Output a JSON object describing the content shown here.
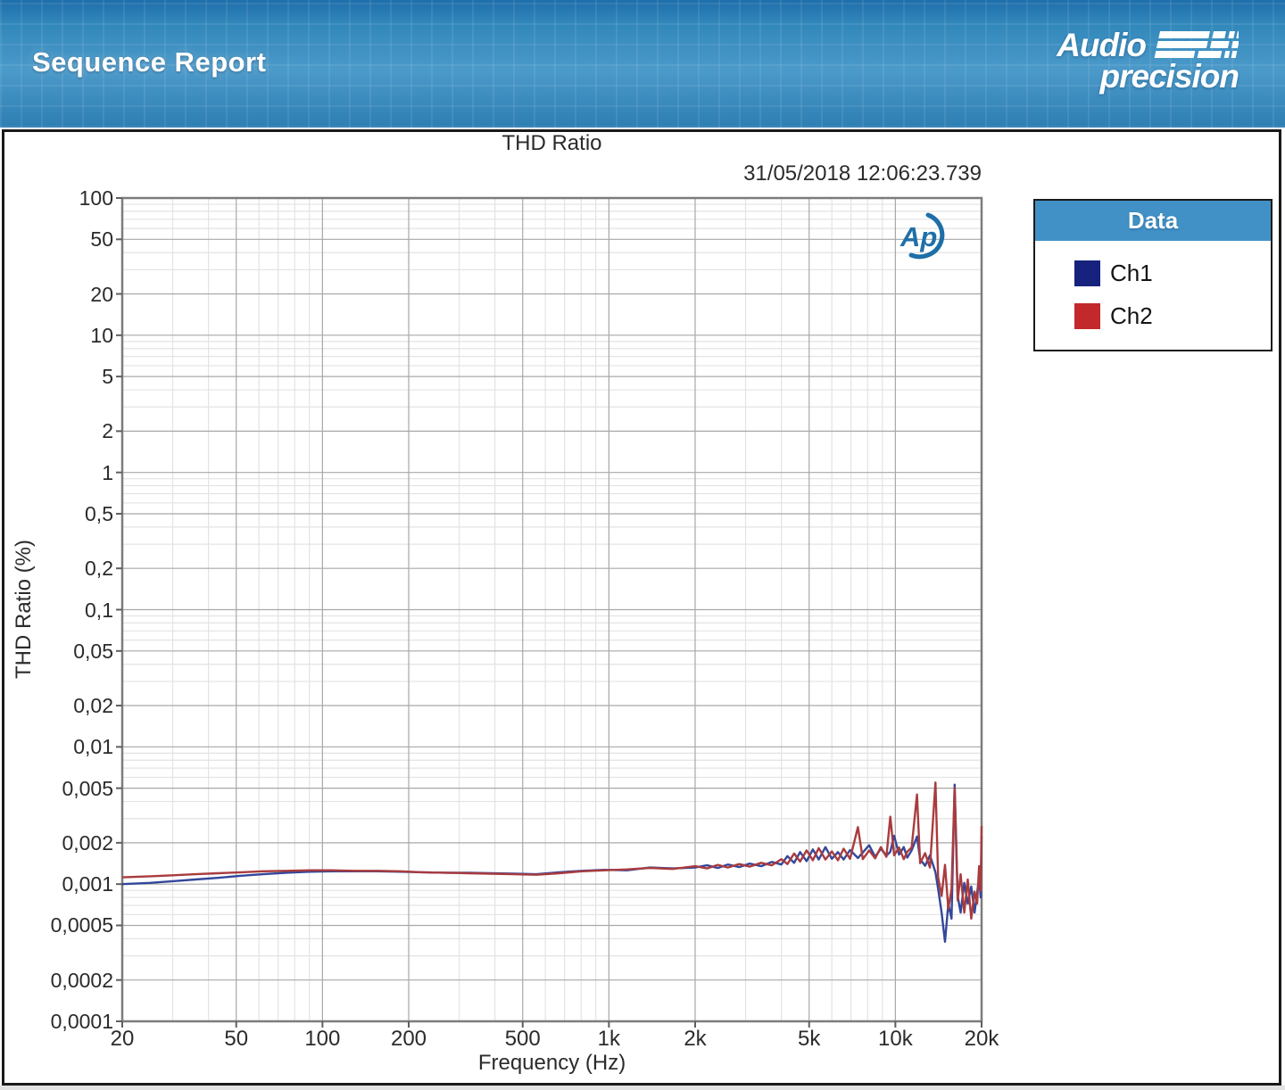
{
  "header": {
    "title": "Sequence Report",
    "brand_word1": "Audio",
    "brand_word2": "precision"
  },
  "report": {
    "timestamp": "31/05/2018 12:06:23.739",
    "legend": {
      "header": "Data",
      "items": [
        {
          "label": "Ch1",
          "color": "#16227d"
        },
        {
          "label": "Ch2",
          "color": "#c2282c"
        }
      ]
    }
  },
  "colors": {
    "banner_blue": "#3187ba",
    "legend_header_blue": "#4191c6",
    "ap_mark_blue": "#1e6fa8",
    "grid_major": "#a8a8a8",
    "grid_minor": "#e3e3e3",
    "plot_border": "#7c7c7c",
    "ch1_trace": "#33479a",
    "ch2_trace": "#a93b3e"
  },
  "chart_data": {
    "type": "line",
    "title": "THD Ratio",
    "xlabel": "Frequency (Hz)",
    "ylabel": "THD Ratio (%)",
    "x_scale": "log",
    "y_scale": "log",
    "xlim": [
      20,
      20000
    ],
    "ylim": [
      0.0001,
      100
    ],
    "grid": "log major+minor",
    "legend_position": "top-right outside",
    "x_ticks": [
      {
        "v": 20,
        "label": "20"
      },
      {
        "v": 50,
        "label": "50"
      },
      {
        "v": 100,
        "label": "100"
      },
      {
        "v": 200,
        "label": "200"
      },
      {
        "v": 500,
        "label": "500"
      },
      {
        "v": 1000,
        "label": "1k"
      },
      {
        "v": 2000,
        "label": "2k"
      },
      {
        "v": 5000,
        "label": "5k"
      },
      {
        "v": 10000,
        "label": "10k"
      },
      {
        "v": 20000,
        "label": "20k"
      }
    ],
    "y_ticks": [
      {
        "v": 100,
        "label": "100"
      },
      {
        "v": 50,
        "label": "50"
      },
      {
        "v": 20,
        "label": "20"
      },
      {
        "v": 10,
        "label": "10"
      },
      {
        "v": 5,
        "label": "5"
      },
      {
        "v": 2,
        "label": "2"
      },
      {
        "v": 1,
        "label": "1"
      },
      {
        "v": 0.5,
        "label": "0,5"
      },
      {
        "v": 0.2,
        "label": "0,2"
      },
      {
        "v": 0.1,
        "label": "0,1"
      },
      {
        "v": 0.05,
        "label": "0,05"
      },
      {
        "v": 0.02,
        "label": "0,02"
      },
      {
        "v": 0.01,
        "label": "0,01"
      },
      {
        "v": 0.005,
        "label": "0,005"
      },
      {
        "v": 0.002,
        "label": "0,002"
      },
      {
        "v": 0.001,
        "label": "0,001"
      },
      {
        "v": 0.0005,
        "label": "0,0005"
      },
      {
        "v": 0.0002,
        "label": "0,0002"
      },
      {
        "v": 0.0001,
        "label": "0,0001"
      }
    ],
    "series": [
      {
        "name": "Ch1",
        "color": "#33479a",
        "points": [
          [
            20,
            0.001
          ],
          [
            25,
            0.00102
          ],
          [
            30,
            0.00105
          ],
          [
            36,
            0.00108
          ],
          [
            43,
            0.00111
          ],
          [
            52,
            0.00115
          ],
          [
            62,
            0.00118
          ],
          [
            75,
            0.00121
          ],
          [
            90,
            0.00123
          ],
          [
            108,
            0.00124
          ],
          [
            130,
            0.00124
          ],
          [
            156,
            0.00124
          ],
          [
            187,
            0.00123
          ],
          [
            224,
            0.00122
          ],
          [
            269,
            0.00121
          ],
          [
            323,
            0.00121
          ],
          [
            388,
            0.0012
          ],
          [
            465,
            0.00119
          ],
          [
            558,
            0.00118
          ],
          [
            670,
            0.00122
          ],
          [
            804,
            0.00125
          ],
          [
            965,
            0.00127
          ],
          [
            1158,
            0.00126
          ],
          [
            1390,
            0.00132
          ],
          [
            1668,
            0.0013
          ],
          [
            2002,
            0.00132
          ],
          [
            2200,
            0.00137
          ],
          [
            2400,
            0.00131
          ],
          [
            2600,
            0.00139
          ],
          [
            2850,
            0.00133
          ],
          [
            3100,
            0.00141
          ],
          [
            3400,
            0.00135
          ],
          [
            3700,
            0.00145
          ],
          [
            4000,
            0.00139
          ],
          [
            4200,
            0.0016
          ],
          [
            4430,
            0.00143
          ],
          [
            4650,
            0.00171
          ],
          [
            4900,
            0.00147
          ],
          [
            5150,
            0.00179
          ],
          [
            5400,
            0.00151
          ],
          [
            5700,
            0.00186
          ],
          [
            6000,
            0.00153
          ],
          [
            6300,
            0.00171
          ],
          [
            6600,
            0.00151
          ],
          [
            6950,
            0.00177
          ],
          [
            7400,
            0.00155
          ],
          [
            7700,
            0.0017
          ],
          [
            8100,
            0.00192
          ],
          [
            8500,
            0.00158
          ],
          [
            8900,
            0.00181
          ],
          [
            9300,
            0.00161
          ],
          [
            9600,
            0.00172
          ],
          [
            9900,
            0.00225
          ],
          [
            10300,
            0.00164
          ],
          [
            10700,
            0.00186
          ],
          [
            11000,
            0.00156
          ],
          [
            11400,
            0.00176
          ],
          [
            11900,
            0.00222
          ],
          [
            12200,
            0.00152
          ],
          [
            12700,
            0.00136
          ],
          [
            13200,
            0.00162
          ],
          [
            13800,
            0.00122
          ],
          [
            14100,
            0.00092
          ],
          [
            14500,
            0.00062
          ],
          [
            14900,
            0.00038
          ],
          [
            15300,
            0.00072
          ],
          [
            15700,
            0.00056
          ],
          [
            16100,
            0.0053
          ],
          [
            16500,
            0.00082
          ],
          [
            16900,
            0.00062
          ],
          [
            17400,
            0.00102
          ],
          [
            17900,
            0.00072
          ],
          [
            18400,
            0.00096
          ],
          [
            18900,
            0.00062
          ],
          [
            19300,
            0.00086
          ],
          [
            19600,
            0.00112
          ],
          [
            19850,
            0.0008
          ],
          [
            20000,
            0.00225
          ]
        ]
      },
      {
        "name": "Ch2",
        "color": "#a93b3e",
        "points": [
          [
            20,
            0.00112
          ],
          [
            25,
            0.00114
          ],
          [
            30,
            0.00116
          ],
          [
            36,
            0.00118
          ],
          [
            43,
            0.0012
          ],
          [
            52,
            0.00122
          ],
          [
            62,
            0.00124
          ],
          [
            75,
            0.00125
          ],
          [
            90,
            0.00126
          ],
          [
            108,
            0.00126
          ],
          [
            130,
            0.00125
          ],
          [
            156,
            0.00125
          ],
          [
            187,
            0.00124
          ],
          [
            224,
            0.00122
          ],
          [
            269,
            0.00121
          ],
          [
            323,
            0.0012
          ],
          [
            388,
            0.00119
          ],
          [
            465,
            0.00118
          ],
          [
            558,
            0.00117
          ],
          [
            670,
            0.0012
          ],
          [
            804,
            0.00124
          ],
          [
            965,
            0.00126
          ],
          [
            1158,
            0.00128
          ],
          [
            1390,
            0.00131
          ],
          [
            1668,
            0.00129
          ],
          [
            2002,
            0.00135
          ],
          [
            2200,
            0.0013
          ],
          [
            2400,
            0.00138
          ],
          [
            2600,
            0.00132
          ],
          [
            2850,
            0.0014
          ],
          [
            3100,
            0.00134
          ],
          [
            3400,
            0.00143
          ],
          [
            3700,
            0.00137
          ],
          [
            4000,
            0.00152
          ],
          [
            4200,
            0.0014
          ],
          [
            4430,
            0.00167
          ],
          [
            4650,
            0.00146
          ],
          [
            4900,
            0.00176
          ],
          [
            5150,
            0.00149
          ],
          [
            5400,
            0.00183
          ],
          [
            5700,
            0.00151
          ],
          [
            6000,
            0.00173
          ],
          [
            6300,
            0.00149
          ],
          [
            6600,
            0.00181
          ],
          [
            6950,
            0.00153
          ],
          [
            7400,
            0.0026
          ],
          [
            7700,
            0.00152
          ],
          [
            8100,
            0.00176
          ],
          [
            8500,
            0.00154
          ],
          [
            8900,
            0.00186
          ],
          [
            9300,
            0.00158
          ],
          [
            9600,
            0.0031
          ],
          [
            9900,
            0.00162
          ],
          [
            10300,
            0.00185
          ],
          [
            10700,
            0.00152
          ],
          [
            11000,
            0.00172
          ],
          [
            11400,
            0.00185
          ],
          [
            11900,
            0.0045
          ],
          [
            12200,
            0.00142
          ],
          [
            12700,
            0.00168
          ],
          [
            13200,
            0.00132
          ],
          [
            13800,
            0.0055
          ],
          [
            14100,
            0.00112
          ],
          [
            14500,
            0.00082
          ],
          [
            14900,
            0.00138
          ],
          [
            15300,
            0.00066
          ],
          [
            15700,
            0.00092
          ],
          [
            16100,
            0.005
          ],
          [
            16500,
            0.00076
          ],
          [
            16900,
            0.00118
          ],
          [
            17400,
            0.00062
          ],
          [
            17900,
            0.00108
          ],
          [
            18400,
            0.00056
          ],
          [
            18900,
            0.00088
          ],
          [
            19300,
            0.00072
          ],
          [
            19600,
            0.00135
          ],
          [
            19850,
            0.0009
          ],
          [
            20000,
            0.00265
          ]
        ]
      }
    ]
  }
}
